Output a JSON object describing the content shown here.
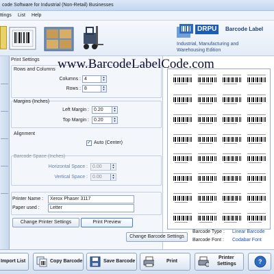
{
  "window": {
    "title": "code Software for Industrial (Non-Retail) Businesses"
  },
  "menu": {
    "items": [
      "ttings",
      "List",
      "Help"
    ]
  },
  "header": {
    "brand_box": "DRPU",
    "brand_name": "Barcode Label",
    "subtitle_line1": "Industrial, Manufacturing and",
    "subtitle_line2": "Warehousing Edition"
  },
  "watermark": "www.BarcodeLabelCode.com",
  "print_settings": {
    "title": "Print Settings",
    "rows_columns": {
      "title": "Rows and Columns",
      "columns_label": "Columns :",
      "columns_value": "4",
      "rows_label": "Rows :",
      "rows_value": "8"
    },
    "margins": {
      "title": "Margins (Inches)",
      "left_label": "Left Margin :",
      "left_value": "0.20",
      "top_label": "Top Margin :",
      "top_value": "0.20"
    },
    "alignment": {
      "title": "Alignment",
      "auto_label": "Auto (Center)",
      "auto_checked": true
    },
    "barcode_space": {
      "title": "Barcode Space (Inches)",
      "horizontal_label": "Horizontal Space :",
      "horizontal_value": "0.00",
      "vertical_label": "Vertical Space :",
      "vertical_value": "0.00"
    },
    "printer_name_label": "Printer Name :",
    "printer_name_value": "Xerox Phaser 3117",
    "paper_used_label": "Paper used :",
    "paper_used_value": "Letter",
    "change_printer_button": "Change Printer Settings",
    "print_preview_button": "Print Preview"
  },
  "barcode_info": {
    "change_barcode_button": "Change Barcode Settings",
    "type_label": "Barcode Type :",
    "type_value": "Linear Barcode",
    "font_label": "Barcode Font :",
    "font_value": "Codabar Font"
  },
  "preview": {
    "columns": 4,
    "rows": 8
  },
  "toolbar": {
    "import_list": "Import List",
    "copy_barcode": "Copy Barcode",
    "save_barcode": "Save Barcode",
    "print": "Print",
    "printer_settings_line1": "Printer",
    "printer_settings_line2": "Settings",
    "help": "?"
  }
}
